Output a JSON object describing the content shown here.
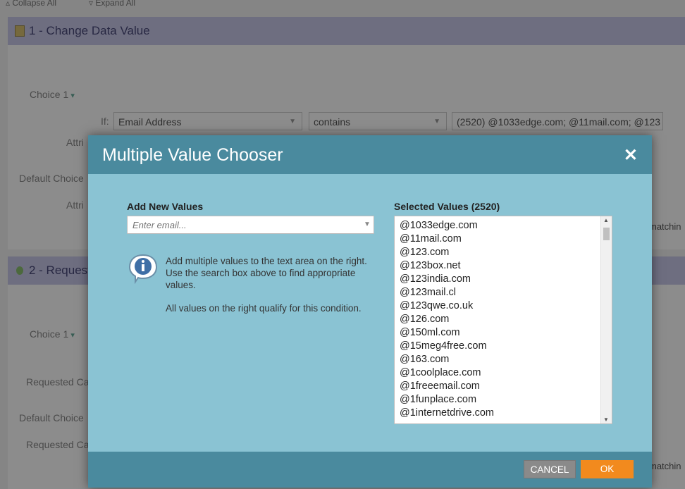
{
  "toolbar": {
    "collapse_all": "Collapse All",
    "expand_all": "Expand All"
  },
  "flow1": {
    "title": "1 - Change Data Value",
    "choice_label": "Choice 1",
    "if_label": "If:",
    "field_value": "Email Address",
    "operator_value": "contains",
    "values_summary": "(2520) @1033edge.com; @11mail.com; @123",
    "attrib_label": "Attri",
    "default_choice_label": "Default Choice",
    "attrib2_label": "Attri",
    "matching_text": "matchin"
  },
  "flow2": {
    "title": "2 - Request",
    "choice_label": "Choice 1",
    "requested_label": "Requested Ca",
    "default_choice_label": "Default Choice",
    "requested2_label": "Requested Ca",
    "matching_text": "matchin"
  },
  "dialog": {
    "title": "Multiple Value Chooser",
    "add_label": "Add New Values",
    "email_placeholder": "Enter email...",
    "info_text": "Add multiple values to the text area on the right. Use the search box above to find appropriate values.",
    "info_text2": "All values on the right qualify for this condition.",
    "selected_label": "Selected Values (2520)",
    "selected_values": [
      "@1033edge.com",
      "@11mail.com",
      "@123.com",
      "@123box.net",
      "@123india.com",
      "@123mail.cl",
      "@123qwe.co.uk",
      "@126.com",
      "@150ml.com",
      "@15meg4free.com",
      "@163.com",
      "@1coolplace.com",
      "@1freeemail.com",
      "@1funplace.com",
      "@1internetdrive.com"
    ],
    "cancel_label": "CANCEL",
    "ok_label": "OK"
  },
  "icons": {
    "close": "close-icon",
    "info": "info-icon",
    "dropdown": "chevron-down-icon"
  },
  "colors": {
    "header": "#4a8a9e",
    "body": "#8ac3d3",
    "ok": "#f28a1e",
    "cancel": "#8a8a8a"
  }
}
